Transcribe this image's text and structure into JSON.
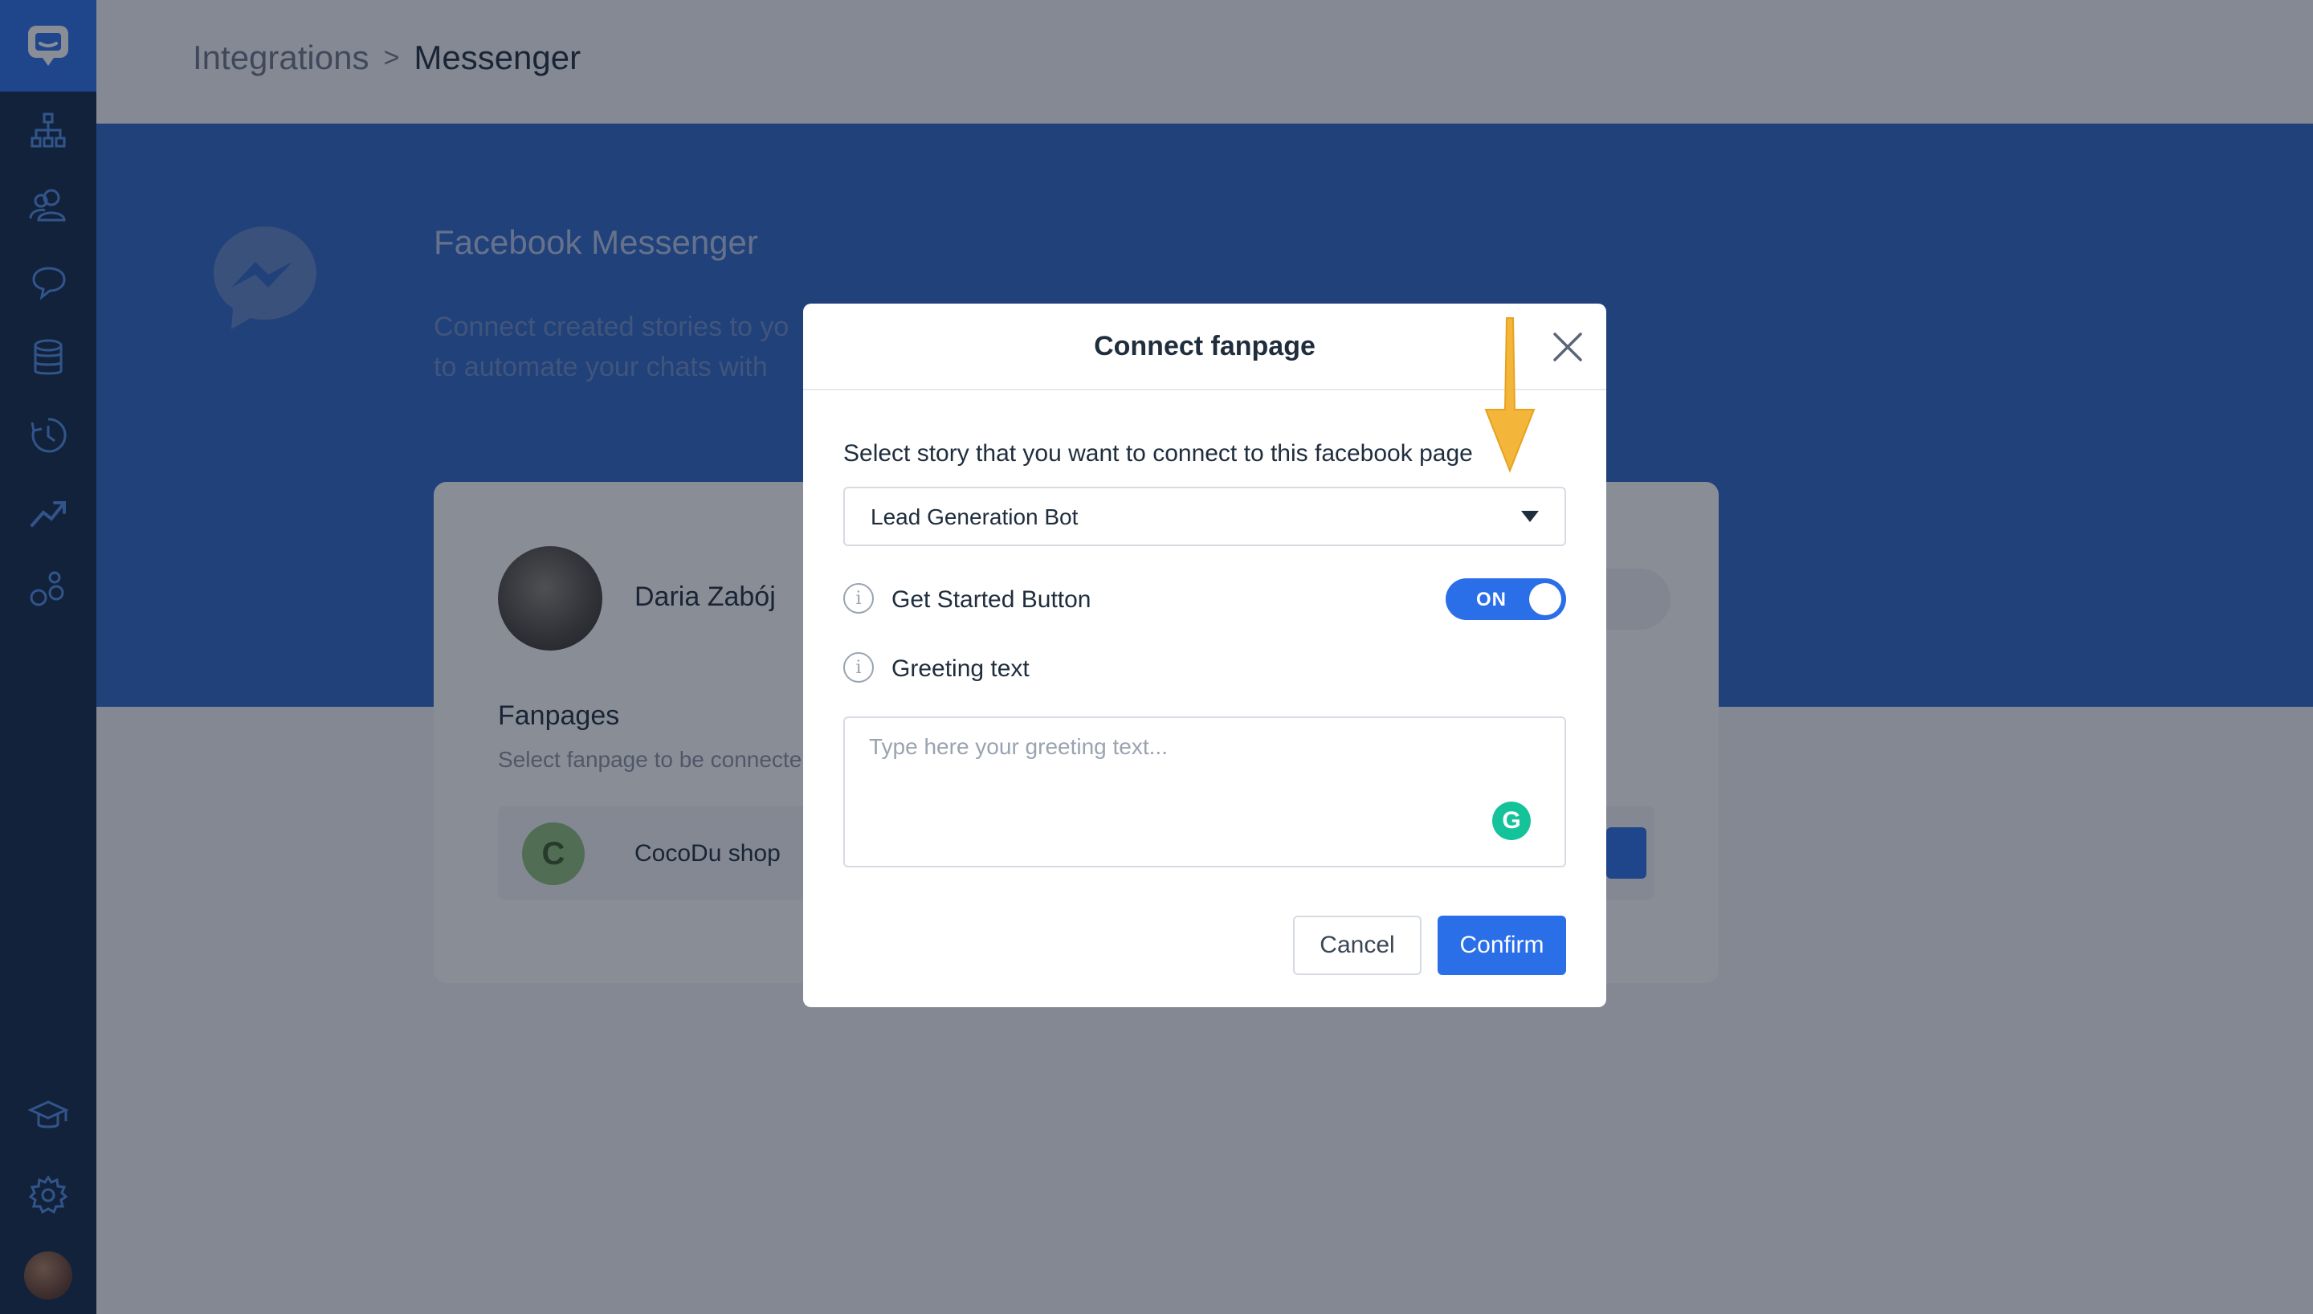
{
  "app": {
    "accent_color": "#2a6fe8",
    "sidebar_color": "#132848"
  },
  "breadcrumb": {
    "parent": "Integrations",
    "separator": ">",
    "current": "Messenger"
  },
  "hero": {
    "title": "Facebook Messenger",
    "description_line1": "Connect created stories to yo",
    "description_line2": "to automate your chats with"
  },
  "card": {
    "user_name": "Daria Zabój",
    "fanpages_title": "Fanpages",
    "fanpages_subtitle": "Select fanpage to be connecte",
    "fanpage_initial": "C",
    "fanpage_name": "CocoDu shop"
  },
  "modal": {
    "title": "Connect fanpage",
    "select_label": "Select story that you want to connect to this facebook page",
    "select_value": "Lead Generation Bot",
    "get_started_label": "Get Started Button",
    "toggle_state": "ON",
    "greeting_label": "Greeting text",
    "greeting_placeholder": "Type here your greeting text...",
    "greeting_value": "",
    "cancel_label": "Cancel",
    "confirm_label": "Confirm"
  },
  "icons": {
    "sidebar": [
      "app-logo-icon",
      "sitemap-icon",
      "users-icon",
      "chat-bubble-icon",
      "database-icon",
      "history-icon",
      "trending-up-icon",
      "bubbles-icon",
      "graduation-cap-icon",
      "gear-icon"
    ],
    "info": "info-icon",
    "close": "close-icon",
    "caret": "chevron-down-icon",
    "grammarly": "grammarly-icon",
    "annotation_arrow": "arrow-down-icon"
  }
}
